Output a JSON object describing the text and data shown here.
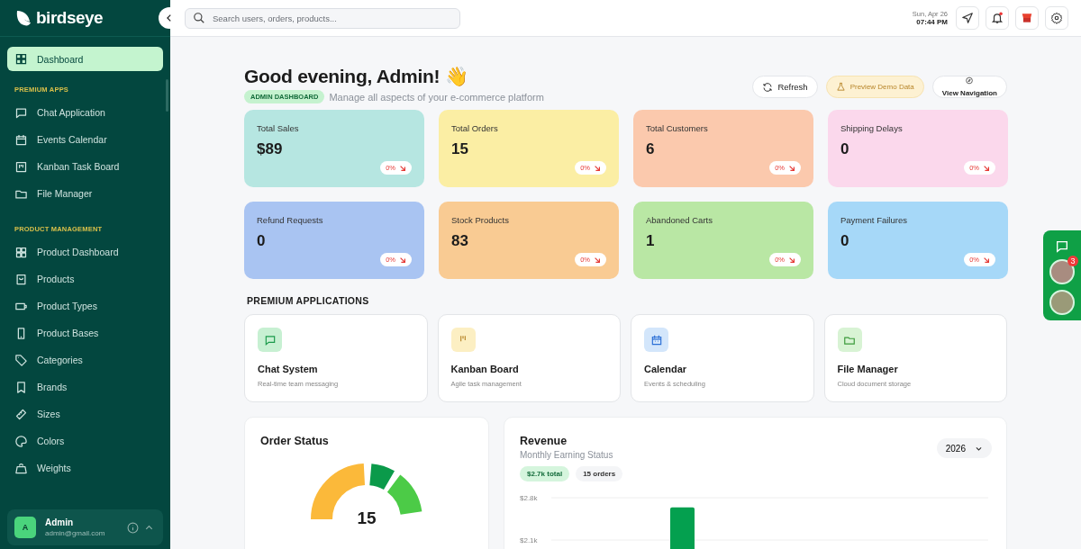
{
  "sidebar": {
    "brand": "birdseye",
    "items": [
      {
        "label": "Dashboard",
        "selected": true
      }
    ],
    "sections": [
      {
        "title": "PREMIUM APPS",
        "items": [
          {
            "label": "Chat Application",
            "selected": false
          },
          {
            "label": "Events Calendar",
            "selected": false
          },
          {
            "label": "Kanban Task Board",
            "selected": false
          },
          {
            "label": "File Manager",
            "selected": false
          }
        ]
      },
      {
        "title": "PRODUCT MANAGEMENT",
        "items": [
          {
            "label": "Product Dashboard",
            "selected": false
          },
          {
            "label": "Products",
            "selected": false
          },
          {
            "label": "Product Types",
            "selected": false
          },
          {
            "label": "Product Bases",
            "selected": false
          },
          {
            "label": "Categories",
            "selected": false
          },
          {
            "label": "Brands",
            "selected": false
          },
          {
            "label": "Sizes",
            "selected": false
          },
          {
            "label": "Colors",
            "selected": false
          },
          {
            "label": "Weights",
            "selected": false
          }
        ]
      }
    ],
    "user": {
      "initial": "A",
      "name": "Admin",
      "email": "admin@gmail.com"
    }
  },
  "topbar": {
    "search": {
      "placeholder": "Search users, orders, products..."
    },
    "date": "Sun, Apr 26",
    "time": "07:44 PM"
  },
  "header": {
    "greeting": "Good evening, Admin! 👋",
    "badge": "ADMIN DASHBOARD",
    "subtitle": "Manage all aspects of your e-commerce platform",
    "buttons": [
      {
        "label": "Refresh",
        "kind": "refresh"
      },
      {
        "label": "Preview Demo Data",
        "kind": "demo"
      },
      {
        "label": "View Navigation",
        "kind": "nav"
      }
    ]
  },
  "stats": [
    {
      "label": "Total Sales",
      "value": "$89",
      "change": "0%",
      "color": "#b6e6e1"
    },
    {
      "label": "Total Orders",
      "value": "15",
      "change": "0%",
      "color": "#fbeea4"
    },
    {
      "label": "Total Customers",
      "value": "6",
      "change": "0%",
      "color": "#fbc9ad"
    },
    {
      "label": "Shipping Delays",
      "value": "0",
      "change": "0%",
      "color": "#fbd8ec"
    },
    {
      "label": "Refund Requests",
      "value": "0",
      "change": "0%",
      "color": "#a9c4f2"
    },
    {
      "label": "Stock Products",
      "value": "83",
      "change": "0%",
      "color": "#f9cb93"
    },
    {
      "label": "Abandoned Carts",
      "value": "1",
      "change": "0%",
      "color": "#b9e7a4"
    },
    {
      "label": "Payment Failures",
      "value": "0",
      "change": "0%",
      "color": "#a6d8f8"
    }
  ],
  "premium_applications": {
    "title": "PREMIUM APPLICATIONS",
    "apps": [
      {
        "title": "Chat System",
        "subtitle": "Real-time team messaging",
        "color": "#c7f0d2"
      },
      {
        "title": "Kanban Board",
        "subtitle": "Agile task management",
        "color": "#fcefc3"
      },
      {
        "title": "Calendar",
        "subtitle": "Events & scheduling",
        "color": "#d3e6fb"
      },
      {
        "title": "File Manager",
        "subtitle": "Cloud document storage",
        "color": "#d8f3d4"
      }
    ]
  },
  "order_status": {
    "title": "Order Status",
    "total": "15"
  },
  "revenue": {
    "title": "Revenue",
    "subtitle": "Monthly Earning Status",
    "total": "$2.7k total",
    "orders": "15 orders",
    "year": "2026",
    "chart_data": {
      "type": "bar",
      "ylim": [
        0,
        2800
      ],
      "yticks": [
        {
          "value": 2100,
          "label": "$2.1k"
        },
        {
          "value": 2800,
          "label": "$2.8k"
        }
      ],
      "values": [
        null,
        null,
        null,
        2640,
        null,
        null,
        null,
        null,
        null,
        null,
        null,
        null
      ]
    }
  },
  "chat_widget": {
    "badge": "3"
  }
}
